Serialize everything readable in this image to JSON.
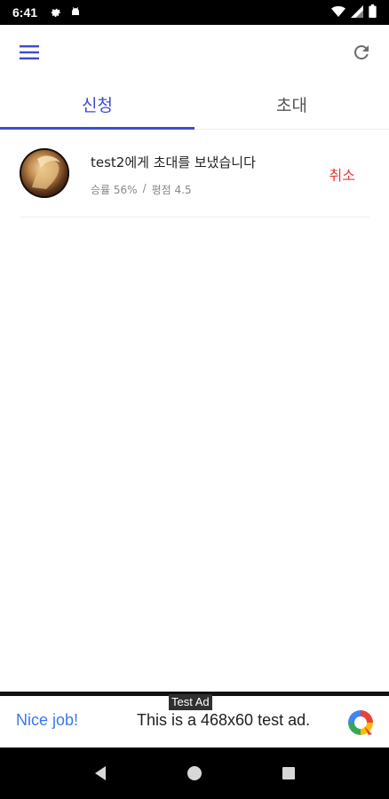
{
  "status_bar": {
    "time": "6:41",
    "left_icons": [
      "gear-icon",
      "android-debug-icon"
    ],
    "right_icons": [
      "wifi-icon",
      "signal-icon",
      "battery-icon"
    ]
  },
  "app_bar": {
    "menu_icon": "hamburger-menu-icon",
    "refresh_icon": "refresh-icon"
  },
  "tabs": [
    {
      "label": "신청",
      "active": true
    },
    {
      "label": "초대",
      "active": false
    }
  ],
  "requests": [
    {
      "title": "test2에게 초대를 보냈습니다",
      "win_rate": "승률 56%",
      "separator": "/",
      "rating": "평점 4.5",
      "action_label": "취소"
    }
  ],
  "ad": {
    "badge": "Test Ad",
    "headline": "Nice job!",
    "body": "This is a 468x60 test ad."
  },
  "colors": {
    "accent": "#3f4bd1",
    "cancel": "#e53935",
    "ad_link": "#3b78e7"
  }
}
